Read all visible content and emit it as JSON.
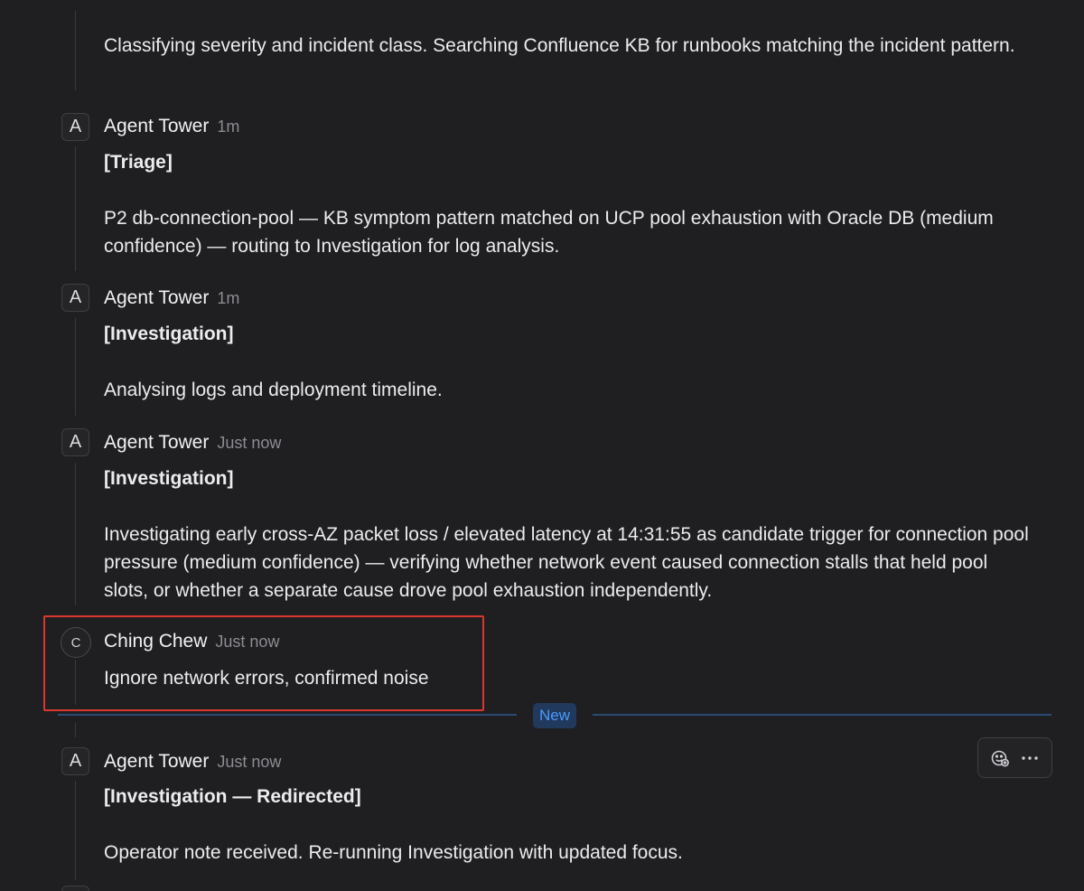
{
  "messages": [
    {
      "body": "Classifying severity and incident class. Searching Confluence KB for runbooks matching the incident pattern."
    },
    {
      "avatar": "A",
      "author": "Agent Tower",
      "time": "1m",
      "tag": "[Triage]",
      "body": "P2 db-connection-pool — KB symptom pattern matched on UCP pool exhaustion with Oracle DB (medium confidence) — routing to Investigation for log analysis."
    },
    {
      "avatar": "A",
      "author": "Agent Tower",
      "time": "1m",
      "tag": "[Investigation]",
      "body": "Analysing logs and deployment timeline."
    },
    {
      "avatar": "A",
      "author": "Agent Tower",
      "time": "Just now",
      "tag": "[Investigation]",
      "body": "Investigating early cross-AZ packet loss / elevated latency at 14:31:55 as candidate trigger for connection pool pressure (medium confidence) — verifying whether network event caused connection stalls that held pool slots, or whether a separate cause drove pool exhaustion independently."
    },
    {
      "avatar": "C",
      "author": "Ching Chew",
      "time": "Just now",
      "body": "Ignore network errors, confirmed noise"
    },
    {
      "avatar": "A",
      "author": "Agent Tower",
      "time": "Just now",
      "tag": "[Investigation — Redirected]",
      "body": "Operator note received. Re-running Investigation with updated focus."
    }
  ],
  "divider": {
    "label": "New",
    "color": "#4d9aff"
  },
  "highlight_color": "#d9382c",
  "icons": {
    "add_reaction": "emoji-add-icon",
    "more": "more-horizontal-icon"
  }
}
